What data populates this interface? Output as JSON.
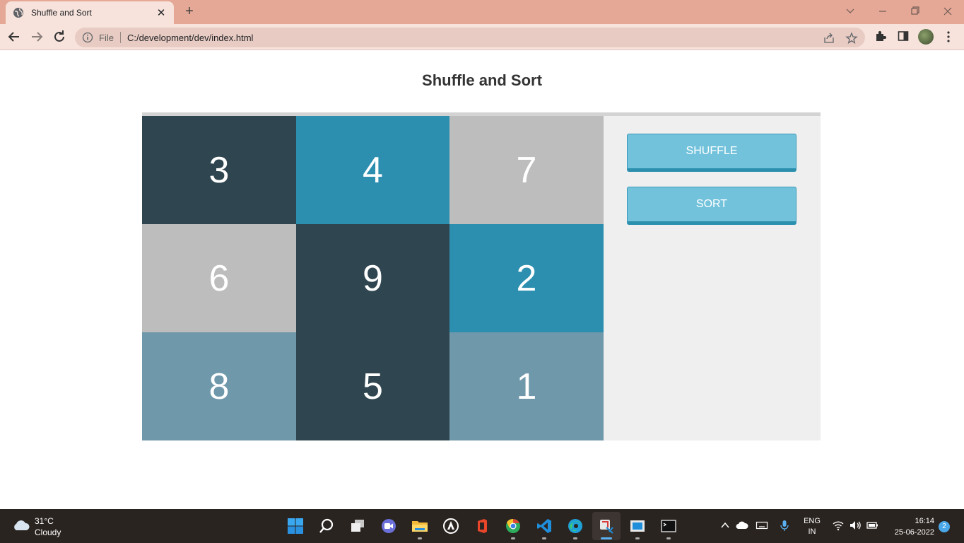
{
  "browser": {
    "tab_title": "Shuffle and Sort",
    "new_tab_symbol": "+",
    "scheme_label": "File",
    "url": "C:/development/dev/index.html",
    "window_controls": [
      "chevron-down-icon",
      "minimize-icon",
      "restore-icon",
      "close-icon"
    ]
  },
  "page": {
    "title": "Shuffle and Sort",
    "cells": [
      {
        "value": "3",
        "color": "#2f4650"
      },
      {
        "value": "4",
        "color": "#2c8fb0"
      },
      {
        "value": "7",
        "color": "#bdbdbd"
      },
      {
        "value": "6",
        "color": "#bdbdbd"
      },
      {
        "value": "9",
        "color": "#2f4650"
      },
      {
        "value": "2",
        "color": "#2c8fb0"
      },
      {
        "value": "8",
        "color": "#6f98aa"
      },
      {
        "value": "5",
        "color": "#2f4650"
      },
      {
        "value": "1",
        "color": "#6f98aa"
      }
    ],
    "shuffle_label": "SHUFFLE",
    "sort_label": "SORT"
  },
  "taskbar": {
    "weather_temp": "31°C",
    "weather_condition": "Cloudy",
    "language_line1": "ENG",
    "language_line2": "IN",
    "time": "16:14",
    "date": "25-06-2022",
    "notification_count": "2"
  }
}
